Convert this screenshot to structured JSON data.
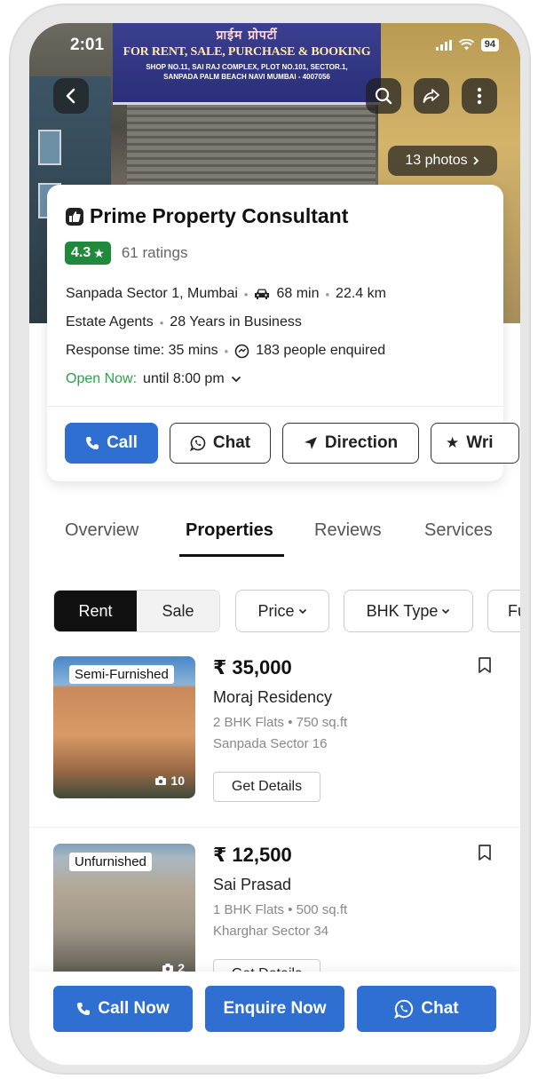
{
  "status_bar": {
    "time": "2:01",
    "battery": "94"
  },
  "hero": {
    "sign_hindi": "प्राईम प्रोपर्टी",
    "sign_main": "FOR RENT, SALE, PURCHASE & BOOKING",
    "sign_address_1": "SHOP NO.11, SAI RAJ COMPLEX, PLOT NO.101, SECTOR.1,",
    "sign_address_2": "SANPADA PALM BEACH NAVI MUMBAI - 4007056",
    "photos_label": "13 photos",
    "icons": {
      "back": "back-arrow-icon",
      "search": "search-icon",
      "share": "share-icon",
      "more": "more-vertical-icon"
    }
  },
  "business": {
    "name": "Prime Property Consultant",
    "rating": "4.3",
    "rating_count": "61 ratings",
    "location": "Sanpada Sector 1, Mumbai",
    "drive_time": "68 min",
    "distance": "22.4 km",
    "category": "Estate Agents",
    "experience": "28 Years in Business",
    "response_time": "Response time: 35 mins",
    "enquired": "183 people enquired",
    "open_status": "Open Now:",
    "hours": "until 8:00 pm"
  },
  "actions": {
    "call": "Call",
    "chat": "Chat",
    "direction": "Direction",
    "write": "Wri"
  },
  "tabs": [
    "Overview",
    "Properties",
    "Reviews",
    "Services"
  ],
  "active_tab": "Properties",
  "filters": {
    "rent": "Rent",
    "sale": "Sale",
    "price": "Price",
    "bhk": "BHK Type",
    "more": "Fu"
  },
  "listings": [
    {
      "tag": "Semi-Furnished",
      "photo_count": "10",
      "price": "₹ 35,000",
      "name": "Moraj Residency",
      "spec": "2 BHK Flats • 750 sq.ft",
      "location": "Sanpada Sector 16",
      "button": "Get Details"
    },
    {
      "tag": "Unfurnished",
      "photo_count": "2",
      "price": "₹ 12,500",
      "name": "Sai Prasad",
      "spec": "1 BHK Flats • 500 sq.ft",
      "location": "Kharghar Sector 34",
      "button": "Get Details"
    }
  ],
  "bottom_bar": {
    "call_now": "Call Now",
    "enquire_now": "Enquire Now",
    "chat": "Chat"
  },
  "colors": {
    "primary": "#2f6fd1",
    "rating_green": "#1f8a3b",
    "open_green": "#2ca34a"
  }
}
